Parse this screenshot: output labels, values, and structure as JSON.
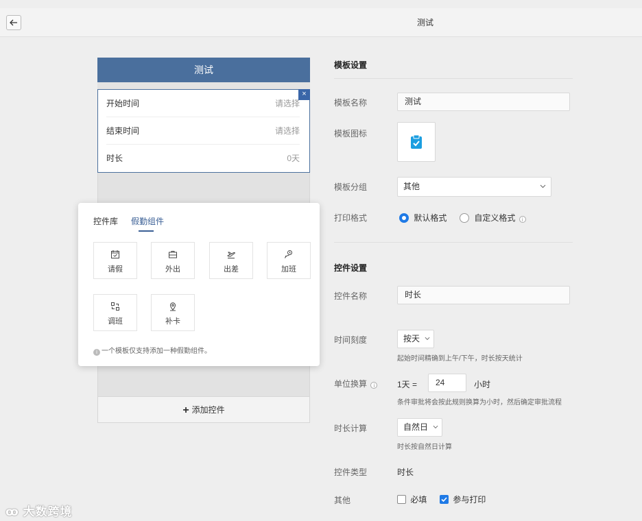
{
  "header": {
    "title": "测试"
  },
  "preview": {
    "title": "测试",
    "rows": [
      {
        "label": "开始时间",
        "value": "请选择"
      },
      {
        "label": "结束时间",
        "value": "请选择"
      },
      {
        "label": "时长",
        "value": "0天"
      }
    ],
    "close_glyph": "×",
    "add_control_label": "添加控件"
  },
  "popup": {
    "tabs": [
      {
        "label": "控件库"
      },
      {
        "label": "假勤组件"
      }
    ],
    "components": [
      {
        "label": "请假",
        "icon": "calendar-check-icon"
      },
      {
        "label": "外出",
        "icon": "briefcase-icon"
      },
      {
        "label": "出差",
        "icon": "plane-icon"
      },
      {
        "label": "加班",
        "icon": "person-clock-icon"
      },
      {
        "label": "调班",
        "icon": "swap-shift-icon"
      },
      {
        "label": "补卡",
        "icon": "location-pin-icon"
      }
    ],
    "note": "一个模板仅支持添加一种假勤组件。"
  },
  "template_settings": {
    "section_title": "模板设置",
    "name_label": "模板名称",
    "name_value": "测试",
    "icon_label": "模板图标",
    "icon_name": "clipboard-check-icon",
    "group_label": "模板分组",
    "group_value": "其他",
    "print_label": "打印格式",
    "print_options": [
      {
        "label": "默认格式",
        "selected": true
      },
      {
        "label": "自定义格式",
        "selected": false
      }
    ]
  },
  "control_settings": {
    "section_title": "控件设置",
    "name_label": "控件名称",
    "name_value": "时长",
    "scale_label": "时间刻度",
    "scale_value": "按天",
    "scale_hint": "起始时间精确到上午/下午，时长按天统计",
    "unit_label": "单位换算",
    "unit_prefix": "1天 =",
    "unit_value": "24",
    "unit_suffix": "小时",
    "unit_hint": "条件审批将会按此规则换算为小时，然后确定审批流程",
    "calc_label": "时长计算",
    "calc_value": "自然日",
    "calc_hint": "时长按自然日计算",
    "type_label": "控件类型",
    "type_value": "时长",
    "other_label": "其他",
    "required_label": "必填",
    "print_label": "参与打印"
  },
  "colors": {
    "accent": "#1f7ae6",
    "header_blue": "#4a6f9d",
    "tab_blue": "#3a5f95"
  },
  "watermark": {
    "text": "大数跨境"
  }
}
